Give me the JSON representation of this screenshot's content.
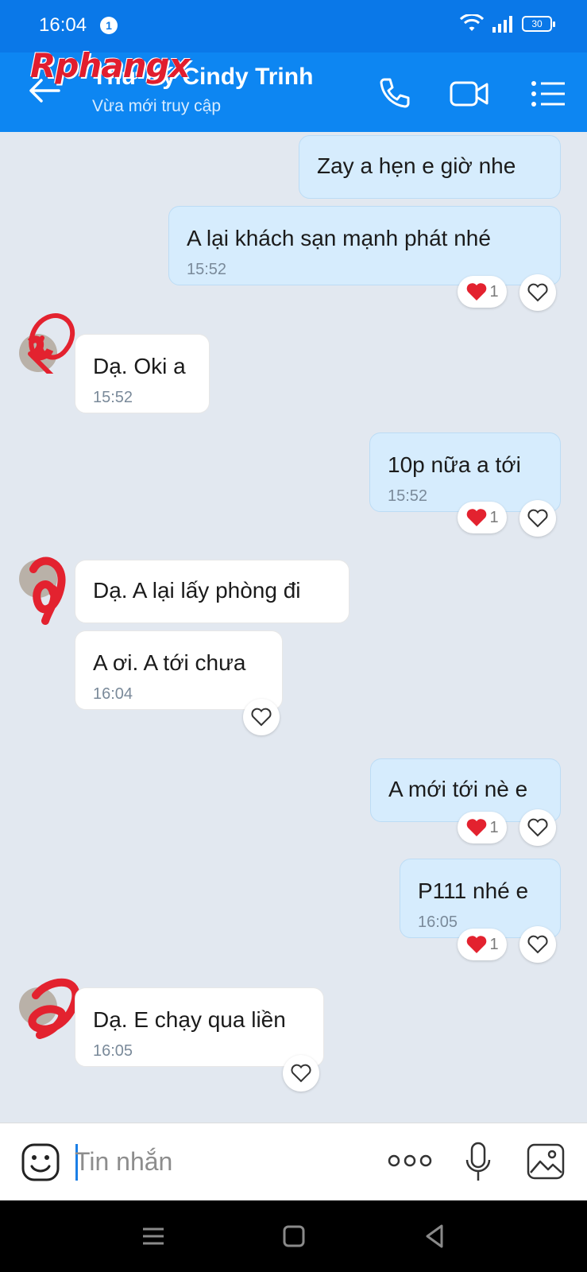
{
  "status_bar": {
    "time": "16:04",
    "notification_count": "1",
    "battery": "30"
  },
  "header": {
    "watermark": "Rphangx",
    "contact_name": "Thư Ký Cindy Trinh",
    "contact_status": "Vừa mới truy cập"
  },
  "messages": [
    {
      "dir": "out",
      "text": "Zay a hẹn e giờ nhe"
    },
    {
      "dir": "out",
      "text": "A lại khách sạn mạnh phát nhé",
      "time": "15:52",
      "reaction_count": "1"
    },
    {
      "dir": "in",
      "text": "Dạ. Oki a",
      "time": "15:52"
    },
    {
      "dir": "out",
      "text": "10p nữa a tới",
      "time": "15:52",
      "reaction_count": "1"
    },
    {
      "dir": "in",
      "text": "Dạ. A lại lấy phòng đi"
    },
    {
      "dir": "in",
      "text": "A ơi. A tới chưa",
      "time": "16:04"
    },
    {
      "dir": "out",
      "text": "A mới tới nè e",
      "reaction_count": "1"
    },
    {
      "dir": "out",
      "text": "P111 nhé e",
      "time": "16:05",
      "reaction_count": "1"
    },
    {
      "dir": "in",
      "text": "Dạ. E chạy qua liền",
      "time": "16:05"
    }
  ],
  "composer": {
    "placeholder": "Tin nhắn"
  },
  "colors": {
    "header": "#0d86f2",
    "background": "#e2e8f0",
    "outgoing_bubble": "#d6ecfd",
    "incoming_bubble": "#ffffff",
    "reaction_heart": "#e3222f"
  },
  "icons": [
    "back-arrow-icon",
    "phone-icon",
    "video-call-icon",
    "menu-icon",
    "emoji-icon",
    "more-icon",
    "microphone-icon",
    "image-icon",
    "heart-icon"
  ]
}
